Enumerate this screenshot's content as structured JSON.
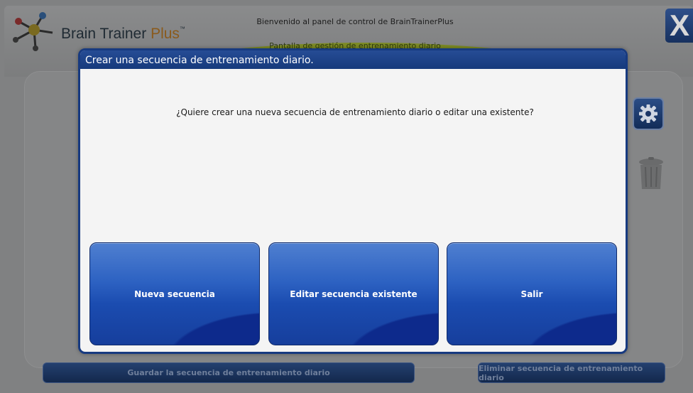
{
  "app": {
    "logo_main": "Brain Trainer ",
    "logo_accent": "Plus",
    "logo_tm": "™",
    "welcome": "Bienvenido al panel de control de BrainTrainerPlus",
    "subtitle": "Pantalla de gestión de entrenamiento diario",
    "close_label": "X",
    "save_label": "Guardar la secuencia de entrenamiento diario",
    "delete_label": "Eliminar secuencia de entrenamiento diario"
  },
  "dialog": {
    "title": "Crear una secuencia de entrenamiento diario.",
    "question": "¿Quiere crear una nueva secuencia de entrenamiento diario o editar una existente?",
    "buttons": [
      {
        "label": "Nueva secuencia"
      },
      {
        "label": "Editar secuencia existente"
      },
      {
        "label": "Salir"
      }
    ]
  },
  "colors": {
    "dialog_border": "#173a80",
    "button_blue": "#1b4cb0",
    "header_green": "#7d8b25"
  }
}
